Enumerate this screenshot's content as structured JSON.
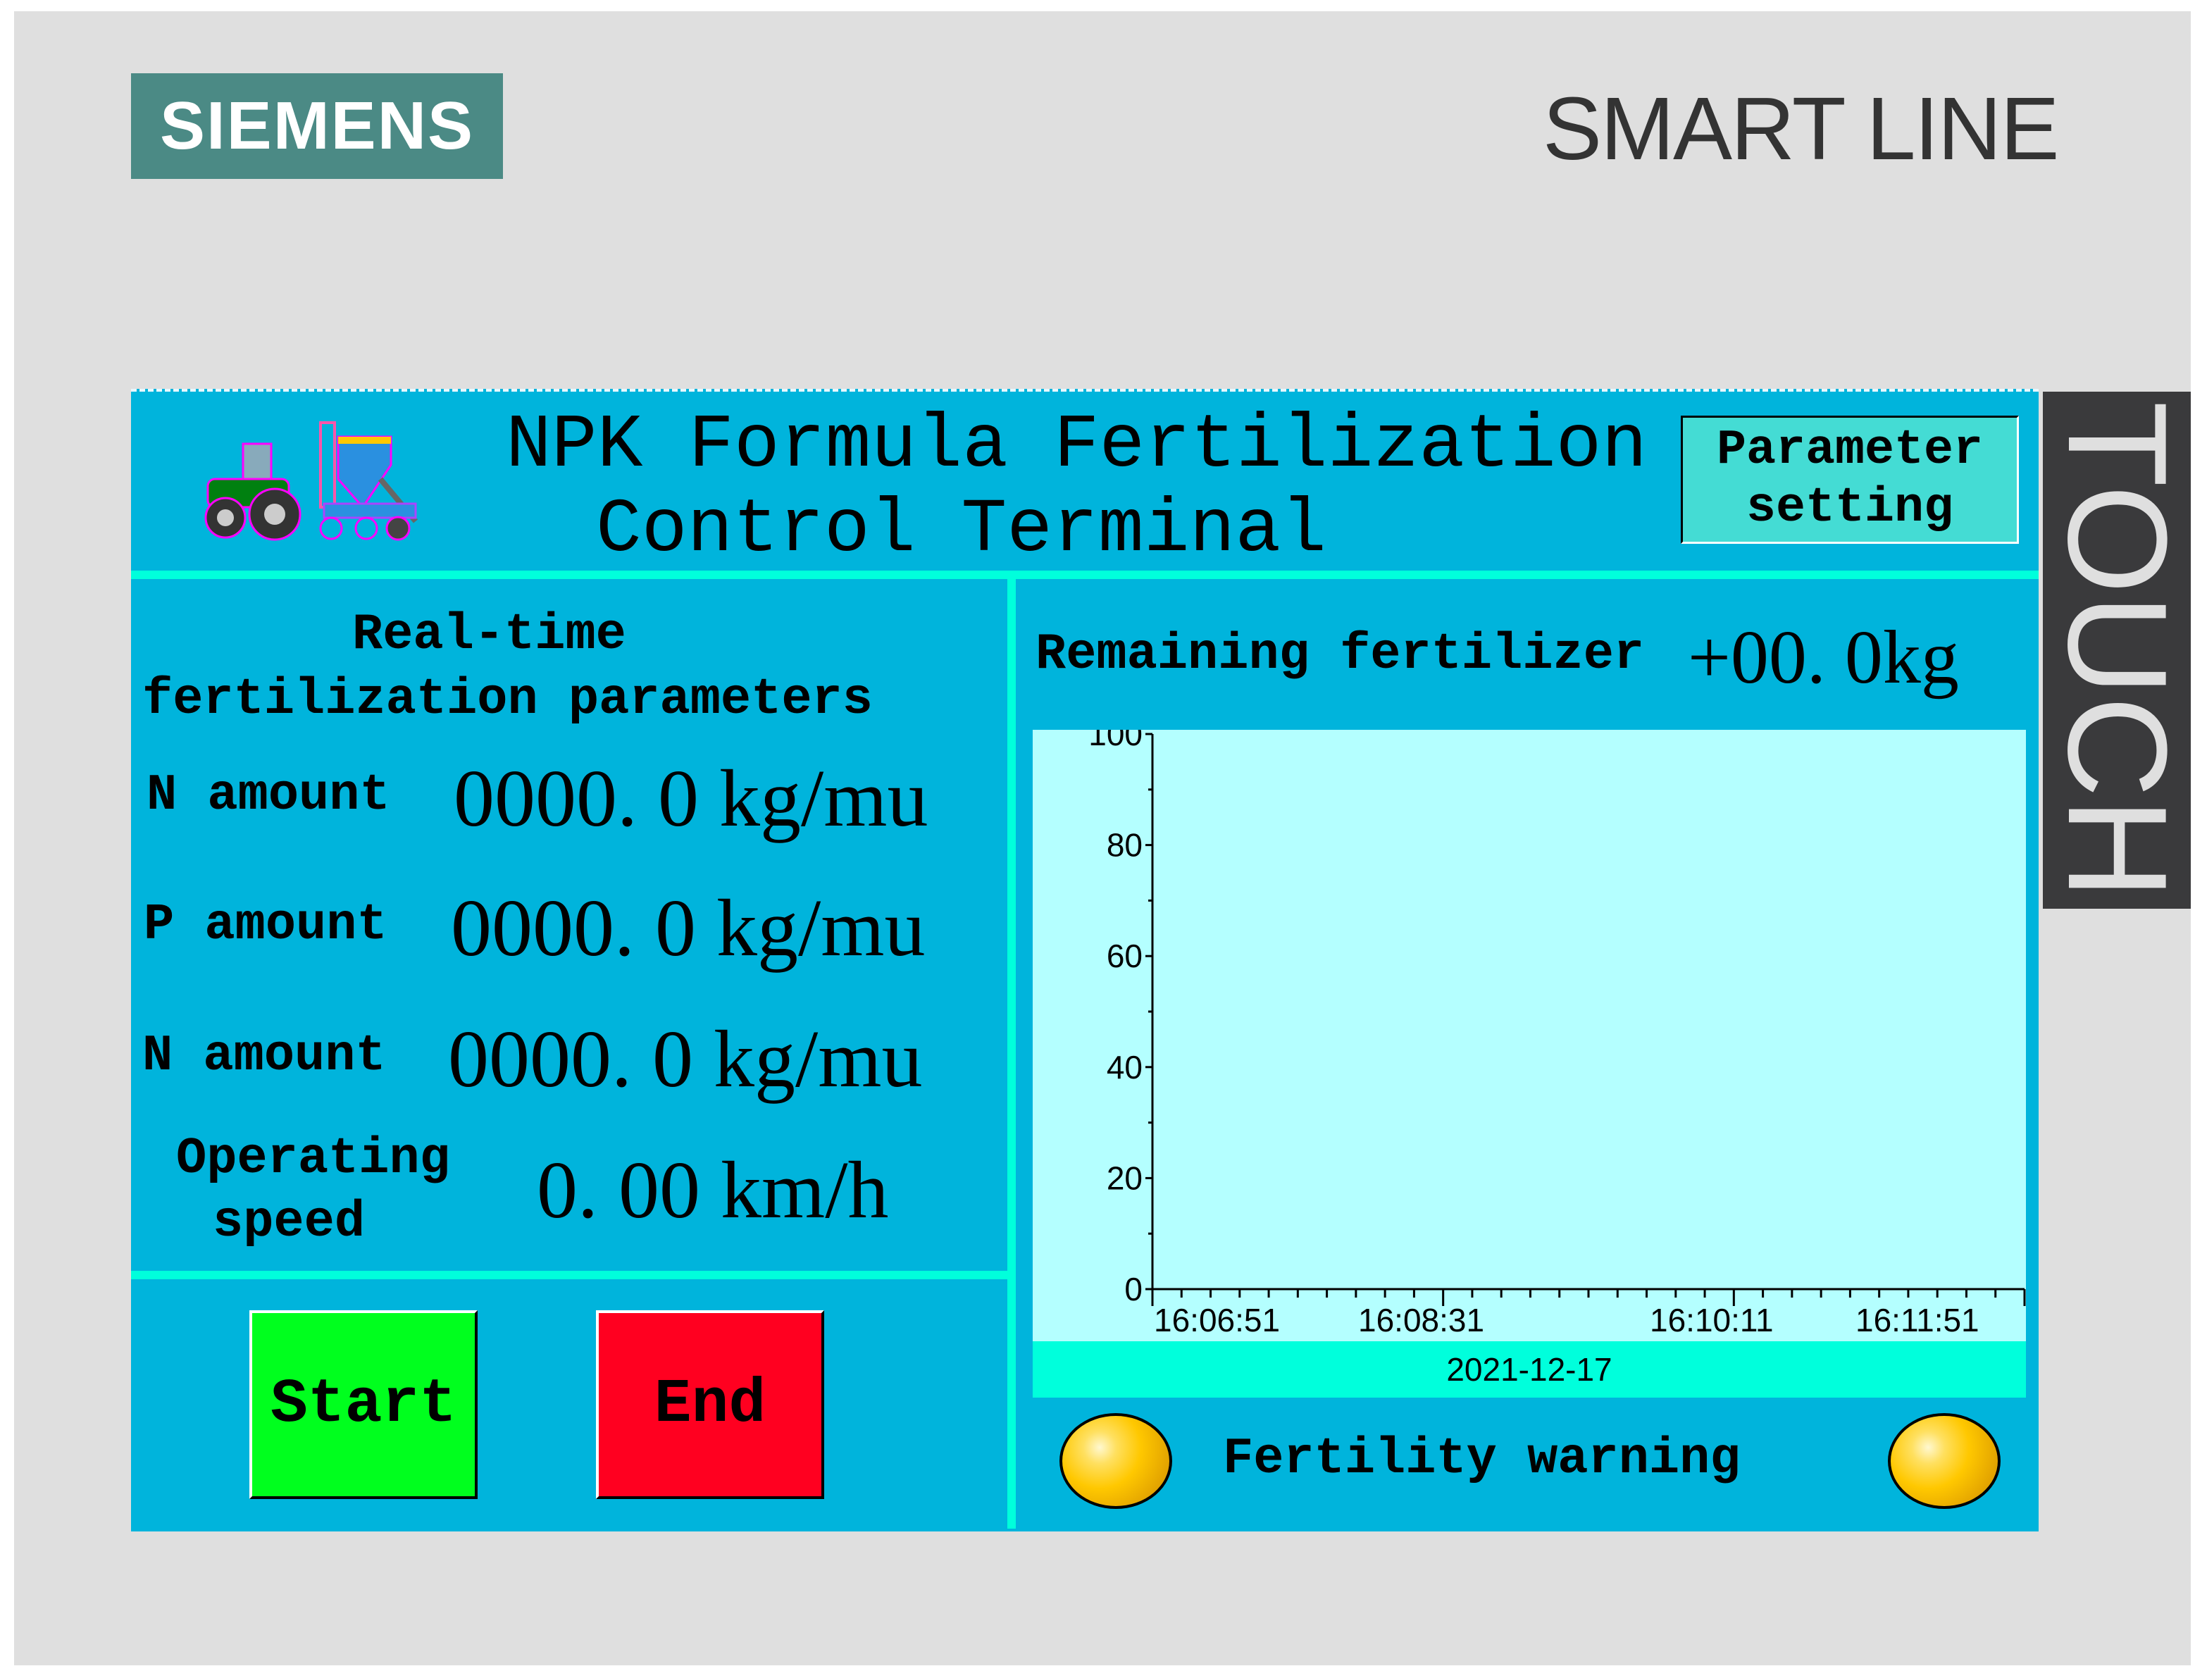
{
  "brand": {
    "logo": "SIEMENS",
    "product": "SMART LINE",
    "touch": "TOUCH"
  },
  "header": {
    "title_line1": "NPK Formula Fertilization",
    "title_line2": "Control Terminal",
    "param_button_line1": "Parameter",
    "param_button_line2": "setting"
  },
  "left": {
    "section_title_line1": "Real-time",
    "section_title_line2": "fertilization parameters",
    "rows": [
      {
        "label": "N amount",
        "value": "0000. 0 kg/mu"
      },
      {
        "label": "P amount",
        "value": "0000. 0 kg/mu"
      },
      {
        "label": "N amount",
        "value": "0000. 0 kg/mu"
      }
    ],
    "speed_label_line1": "Operating",
    "speed_label_line2": "speed",
    "speed_value": "0. 00 km/h",
    "start_label": "Start",
    "end_label": "End"
  },
  "right": {
    "remaining_label": "Remaining fertilizer",
    "remaining_value": "+00. 0kg",
    "warning_label": "Fertility warning"
  },
  "chart_data": {
    "type": "line",
    "title": "",
    "xlabel": "2021-12-17",
    "ylabel": "",
    "ylim": [
      0,
      100
    ],
    "yticks": [
      "0",
      "20",
      "40",
      "60",
      "80",
      "100"
    ],
    "xticks": [
      "16:06:51",
      "16:08:31",
      "16:10:11",
      "16:11:51"
    ],
    "series": []
  },
  "colors": {
    "panel": "#00b4dc",
    "divider": "#00ffdc",
    "plot_bg": "#b4ffff",
    "start": "#00ff1e",
    "end": "#ff0020",
    "lamp": "#ffc800"
  }
}
